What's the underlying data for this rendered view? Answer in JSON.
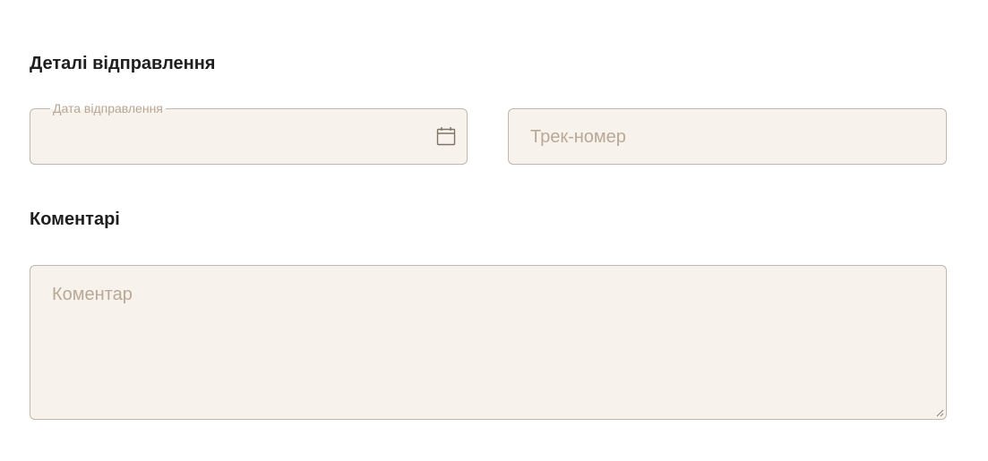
{
  "shipping": {
    "title": "Деталі відправлення",
    "date_label": "Дата відправлення",
    "date_value": "",
    "track_placeholder": "Трек-номер"
  },
  "comments": {
    "title": "Коментарі",
    "comment_placeholder": "Коментар"
  },
  "icons": {
    "date": "calendar-icon",
    "resize": "resize-handle-icon"
  },
  "colors": {
    "field_background": "#f7f3ec",
    "field_border": "#c2b7a8",
    "placeholder": "#b9a896",
    "heading": "#1f1f1f"
  }
}
